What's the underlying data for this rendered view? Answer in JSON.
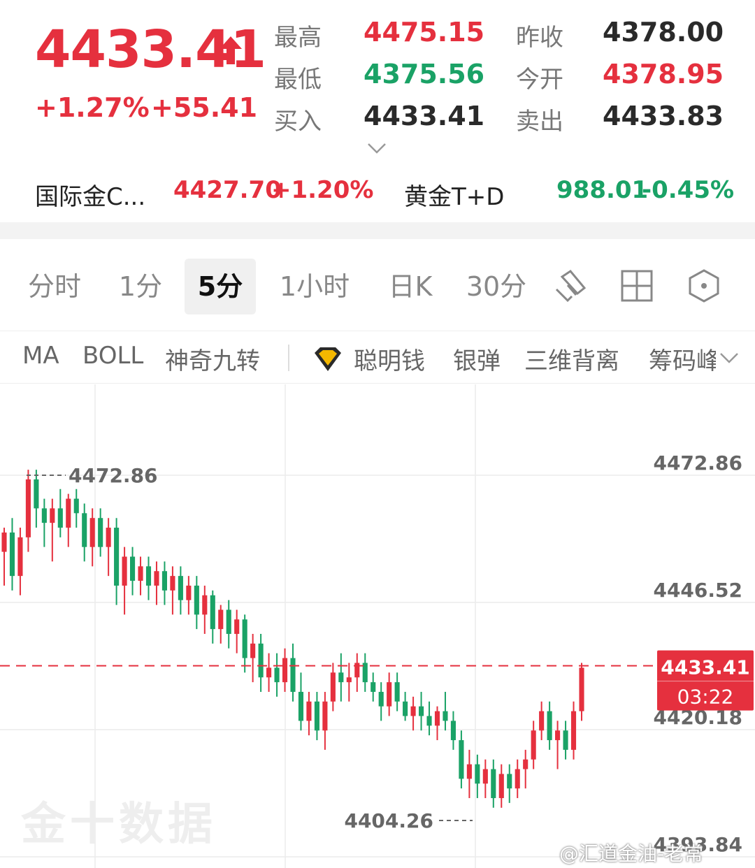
{
  "quote": {
    "price": "4433.41",
    "change_pct": "+1.27%",
    "change_abs": "+55.41",
    "stats": [
      {
        "label": "最高",
        "value": "4475.15",
        "color": "red"
      },
      {
        "label": "昨收",
        "value": "4378.00",
        "color": "dark"
      },
      {
        "label": "最低",
        "value": "4375.56",
        "color": "green"
      },
      {
        "label": "今开",
        "value": "4378.95",
        "color": "red"
      },
      {
        "label": "买入",
        "value": "4433.41",
        "color": "dark"
      },
      {
        "label": "卖出",
        "value": "4433.83",
        "color": "dark"
      }
    ],
    "refs": [
      {
        "label": "国际金C...",
        "price": "4427.70",
        "change": "+1.20%",
        "color": "red"
      },
      {
        "label": "黄金T+D",
        "price": "988.01",
        "change": "-0.45%",
        "color": "green"
      }
    ]
  },
  "tabs": [
    "分时",
    "1分",
    "5分",
    "1小时",
    "日K",
    "30分"
  ],
  "active_tab": "5分",
  "tools": [
    "draw-icon",
    "grid-icon",
    "hexagon-settings-icon"
  ],
  "indicators": [
    "MA",
    "BOLL",
    "神奇九转",
    "聪明钱",
    "银弹",
    "三维背离",
    "筹码峰"
  ],
  "chart_data": {
    "type": "candlestick",
    "y_ticks": [
      "4472.86",
      "4446.52",
      "4420.18",
      "4393.84"
    ],
    "ylim": [
      4393.84,
      4481.0
    ],
    "high_marker": "4472.86",
    "low_marker": "4404.26",
    "current_price": "4433.41",
    "countdown": "03:22",
    "colors": {
      "up": "#e5303e",
      "down": "#1aa266"
    },
    "candles": [
      [
        4457,
        4462,
        4450,
        4461
      ],
      [
        4461,
        4464,
        4449,
        4452
      ],
      [
        4452,
        4462,
        4448,
        4460
      ],
      [
        4460,
        4474,
        4457,
        4472
      ],
      [
        4472,
        4474,
        4462,
        4466
      ],
      [
        4466,
        4468,
        4458,
        4463
      ],
      [
        4463,
        4468,
        4455,
        4466
      ],
      [
        4466,
        4470,
        4460,
        4462
      ],
      [
        4462,
        4469,
        4458,
        4468
      ],
      [
        4468,
        4470,
        4462,
        4465
      ],
      [
        4465,
        4467,
        4455,
        4458
      ],
      [
        4458,
        4466,
        4454,
        4464
      ],
      [
        4464,
        4466,
        4456,
        4458
      ],
      [
        4458,
        4464,
        4452,
        4462
      ],
      [
        4462,
        4464,
        4446,
        4450
      ],
      [
        4450,
        4458,
        4444,
        4456
      ],
      [
        4456,
        4458,
        4448,
        4451
      ],
      [
        4451,
        4456,
        4448,
        4454
      ],
      [
        4454,
        4456,
        4447,
        4450
      ],
      [
        4450,
        4455,
        4446,
        4453
      ],
      [
        4453,
        4455,
        4446,
        4449
      ],
      [
        4449,
        4454,
        4444,
        4452
      ],
      [
        4452,
        4454,
        4444,
        4447
      ],
      [
        4447,
        4452,
        4444,
        4450
      ],
      [
        4450,
        4452,
        4441,
        4444
      ],
      [
        4444,
        4450,
        4440,
        4448
      ],
      [
        4448,
        4449,
        4438,
        4441
      ],
      [
        4441,
        4446,
        4438,
        4445
      ],
      [
        4445,
        4447,
        4437,
        4440
      ],
      [
        4440,
        4445,
        4436,
        4443
      ],
      [
        4443,
        4444,
        4432,
        4435
      ],
      [
        4435,
        4440,
        4430,
        4438
      ],
      [
        4438,
        4440,
        4428,
        4431
      ],
      [
        4431,
        4436,
        4428,
        4433
      ],
      [
        4433,
        4436,
        4427,
        4430
      ],
      [
        4430,
        4437,
        4428,
        4435
      ],
      [
        4435,
        4438,
        4426,
        4428
      ],
      [
        4428,
        4432,
        4420,
        4422
      ],
      [
        4422,
        4428,
        4419,
        4426
      ],
      [
        4426,
        4428,
        4418,
        4420
      ],
      [
        4420,
        4428,
        4416,
        4426
      ],
      [
        4426,
        4434,
        4424,
        4432
      ],
      [
        4432,
        4436,
        4426,
        4430
      ],
      [
        4430,
        4434,
        4426,
        4431
      ],
      [
        4431,
        4436,
        4428,
        4434
      ],
      [
        4434,
        4436,
        4428,
        4430
      ],
      [
        4430,
        4432,
        4426,
        4428
      ],
      [
        4428,
        4430,
        4422,
        4425
      ],
      [
        4425,
        4432,
        4423,
        4430
      ],
      [
        4430,
        4432,
        4424,
        4426
      ],
      [
        4426,
        4428,
        4422,
        4423
      ],
      [
        4423,
        4427,
        4420,
        4425
      ],
      [
        4425,
        4428,
        4420,
        4423
      ],
      [
        4423,
        4426,
        4419,
        4421
      ],
      [
        4421,
        4425,
        4418,
        4424
      ],
      [
        4424,
        4428,
        4420,
        4422
      ],
      [
        4422,
        4424,
        4416,
        4418
      ],
      [
        4418,
        4420,
        4408,
        4410
      ],
      [
        4410,
        4416,
        4406,
        4413
      ],
      [
        4413,
        4415,
        4406,
        4409
      ],
      [
        4409,
        4414,
        4406,
        4412
      ],
      [
        4412,
        4414,
        4404,
        4406
      ],
      [
        4406,
        4413,
        4404,
        4411
      ],
      [
        4411,
        4413,
        4405,
        4408
      ],
      [
        4408,
        4414,
        4406,
        4412
      ],
      [
        4412,
        4416,
        4408,
        4414
      ],
      [
        4414,
        4422,
        4412,
        4420
      ],
      [
        4420,
        4426,
        4418,
        4424
      ],
      [
        4424,
        4426,
        4416,
        4418
      ],
      [
        4418,
        4422,
        4412,
        4420
      ],
      [
        4420,
        4422,
        4414,
        4416
      ],
      [
        4416,
        4426,
        4414,
        4424
      ],
      [
        4424,
        4434,
        4422,
        4433
      ]
    ]
  },
  "watermark": "金十数据",
  "credit": "@汇道金油-老常"
}
